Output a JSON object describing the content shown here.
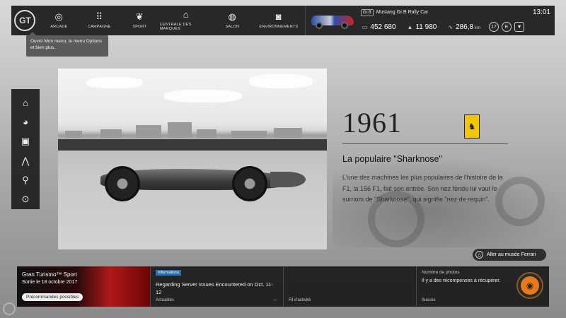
{
  "topbar": {
    "logo_label": "GT",
    "nav": [
      {
        "label": "ARCADE",
        "icon": "steering-wheel-icon",
        "glyph": "◎"
      },
      {
        "label": "CAMPAGNE",
        "icon": "grid-icon",
        "glyph": "⠿"
      },
      {
        "label": "SPORT",
        "icon": "laurel-icon",
        "glyph": "❦"
      },
      {
        "label": "CENTRALE DES MARQUES",
        "icon": "building-icon",
        "glyph": "⌂"
      },
      {
        "label": "SALON",
        "icon": "globe-icon",
        "glyph": "◍"
      },
      {
        "label": "ENVIRONNEMENTS",
        "icon": "camera-icon",
        "glyph": "◙"
      }
    ],
    "car_class": "Gr.B",
    "car_name": "Mustang Gr.B Rally Car",
    "clock": "13:01",
    "credits": "452 680",
    "mileage_points": "11 980",
    "distance": "286,8",
    "distance_unit": "km",
    "level": "17",
    "rank": "E",
    "accent": "#e8791a"
  },
  "tooltip": {
    "text": "Ouvrir Mon menu, le menu Options et bien plus."
  },
  "sidebar": {
    "items": [
      {
        "icon": "home-icon",
        "glyph": "⌂"
      },
      {
        "icon": "palette-icon",
        "glyph": "◕"
      },
      {
        "icon": "gallery-icon",
        "glyph": "▣"
      },
      {
        "icon": "tuning-icon",
        "glyph": "⋀"
      },
      {
        "icon": "search-icon",
        "glyph": "⚲"
      },
      {
        "icon": "disc-icon",
        "glyph": "⊙"
      }
    ]
  },
  "article": {
    "year": "1961",
    "title": "La populaire \"Sharknose\"",
    "body": "L'une des machines les plus populaires de l'histoire de la F1, la 156 F1, fait son entrée. Son nez fendu lui vaut le surnom de \"Sharknose\", qui signifie \"nez de requin\".",
    "badge_glyph": "♞",
    "museum_button": "Aller au musée Ferrari",
    "museum_button_glyph": "△"
  },
  "bottombar": {
    "promo": {
      "title": "Gran Turismo™ Sport",
      "subtitle": "Sortie le 18 octobre 2017",
      "button": "Précommandes possibles"
    },
    "news": {
      "tag": "Informations",
      "text": "Regarding Server Issues Encountered on Oct. 11-12",
      "label": "Actualités",
      "more": "---"
    },
    "feed": {
      "label": "Fil d'activité"
    },
    "photos": {
      "title": "Nombre de photos",
      "text": "Il y a des récompenses à récupérer.",
      "label": "Succès",
      "button_glyph": "◉"
    }
  }
}
